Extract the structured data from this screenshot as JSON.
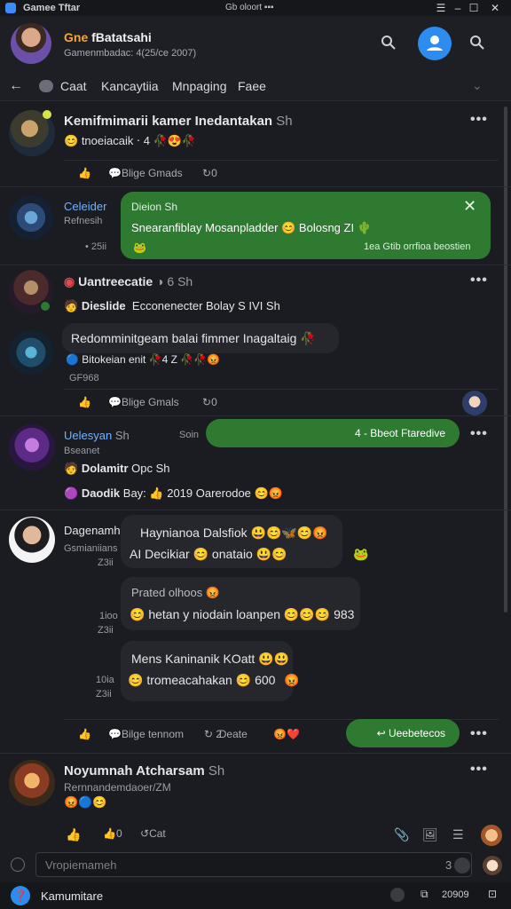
{
  "titlebar": {
    "app_title": "Gamee  Tftar",
    "center_text": "Gb oloort ▪▪▪"
  },
  "header": {
    "name_prefix": "Gne",
    "name": "fBatatsahi",
    "subtitle": "Gamenmbadac: 4(25/ce 2007)"
  },
  "tabs": [
    "Caat",
    "Kancaytiia",
    "Mnpaging",
    "Faee"
  ],
  "posts": [
    {
      "author": "Kemifmimarii kamer Inedantakan",
      "time": "Sh",
      "line": "tnoeiacaik  ⋅ 4",
      "actions": {
        "like": "",
        "comment": "Blige Gmads",
        "share": "0"
      }
    }
  ],
  "message1": {
    "sender": "Celeider",
    "sub": "Refnesih",
    "time": "25ii",
    "card_title": "Dieion  Sh",
    "card_text": "Snearanfiblay Mosanpladder",
    "card_tail": "Bolosng  ZI",
    "card_footer": "1ea Gtib  orrfioa beostien"
  },
  "post2": {
    "author": "Uantreecatie",
    "tag": "6  Sh",
    "line_name": "Dieslide",
    "line_text": "Ecconenecter Bolay S  IVI  Sh"
  },
  "post3": {
    "bubble": "Redomminitgeam balai fimmer Inagaltaig",
    "sub": "Bitokeian enit",
    "sub_tail": "4  Z",
    "footer": "GF968",
    "actions": {
      "comment": "Blige Gmals",
      "share": "0"
    }
  },
  "post4": {
    "author": "Uelesyan",
    "time": "Sh",
    "time2": "Soin",
    "sub": "Bseanet",
    "pill": "4 -  Bbeot Ftaredive",
    "line1_name": "Dolamitr",
    "line1_tail": "Opc  Sh",
    "line2_name": "Daodik",
    "line2_tail": "Bay:",
    "line2_year": "2019 Oarerodoe"
  },
  "post5": {
    "author": "Dagenamhe",
    "sub": "Gsmianiians",
    "sub2": "Z3ii",
    "bubble1_title": "Haynianoa Dalsfiok",
    "bubble1_text": "AI Decikiar",
    "bubble1_tail": "onataio",
    "time_a": "1ioo",
    "time_a2": "Z3ii",
    "bubble2_title": "Prated olhoos",
    "bubble2_text": "hetan y niodain loanpen",
    "bubble2_tail": "983",
    "time_b": "10ia",
    "time_b2": "Z3ii",
    "bubble3_title": "Mens Kaninanik KOatt",
    "bubble3_text": "tromeacahakan",
    "bubble3_tail": "600",
    "actions": {
      "comment": "Bilge tennom",
      "share": "Deate",
      "count": "2"
    },
    "pill": "Ueebetecos"
  },
  "post6": {
    "author": "Noyumnah Atcharsam",
    "time": "Sh",
    "sub": "Rernnandemdaoer/ZM"
  },
  "reactions": {
    "like_count": "0",
    "comment": "Cat"
  },
  "composer": {
    "placeholder": "Vropiemameh",
    "right": "3 G"
  },
  "bottombar": {
    "label": "Kamumitare",
    "right_text": "20909"
  },
  "colors": {
    "accent_green": "#2e7a31",
    "accent_blue": "#2d8cf0",
    "bg": "#1b1c21"
  }
}
